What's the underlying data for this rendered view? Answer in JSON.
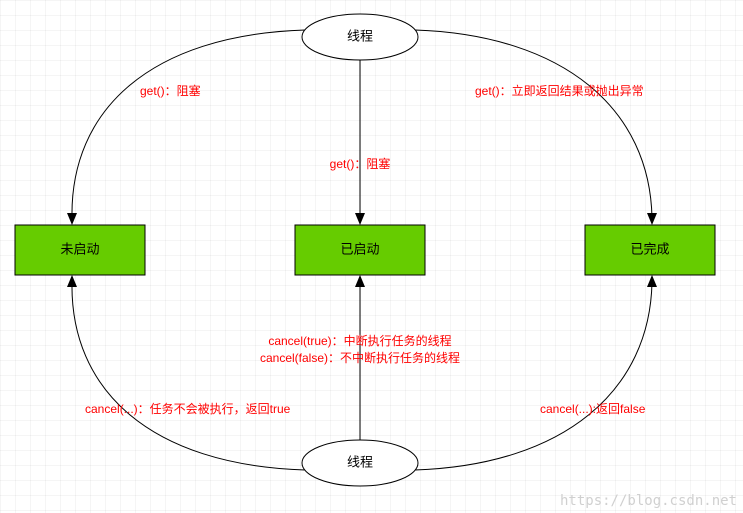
{
  "nodes": {
    "threadTop": "线程",
    "threadBottom": "线程",
    "stateLeft": "未启动",
    "stateMid": "已启动",
    "stateRight": "已完成"
  },
  "edges": {
    "topToLeft": "get()：阻塞",
    "topToMid": "get()：阻塞",
    "topToRight": "get()：立即返回结果或抛出异常",
    "bottomToLeft": "cancel(...)：任务不会被执行，返回true",
    "bottomToMidL1": "cancel(true)：中断执行任务的线程",
    "bottomToMidL2": "cancel(false)：不中断执行任务的线程",
    "bottomToRight": "cancel(...):返回false"
  },
  "watermark": "https://blog.csdn.net"
}
